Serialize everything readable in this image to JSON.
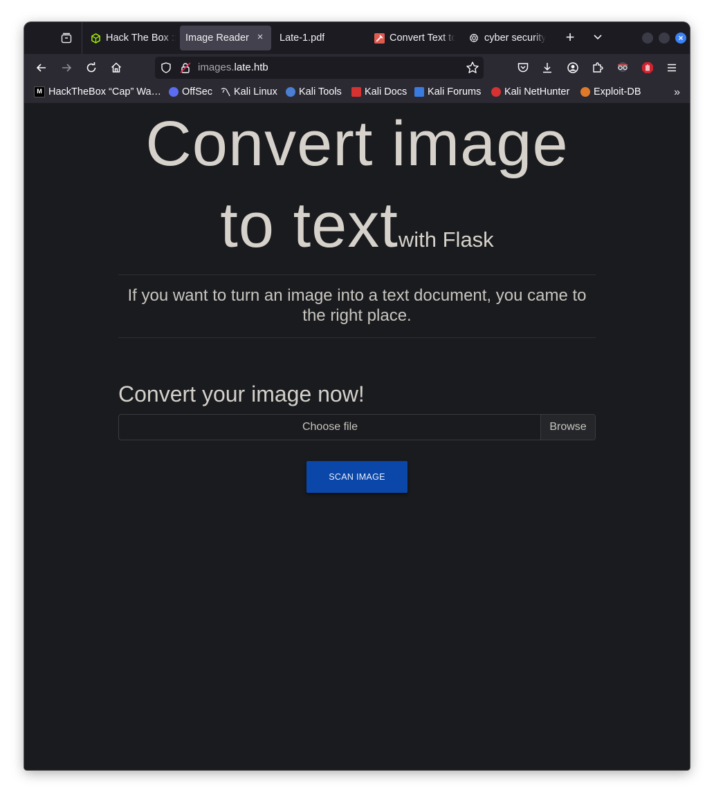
{
  "browser": {
    "tabs": [
      {
        "title": "Hack The Box ::",
        "icon": "htb-cube-icon",
        "active": false
      },
      {
        "title": "Image Reader",
        "icon": "",
        "active": true
      },
      {
        "title": "Late-1.pdf",
        "icon": "pdf-icon",
        "active": false
      },
      {
        "title": "Convert Text to",
        "icon": "tool-icon",
        "active": false
      },
      {
        "title": "cyber security",
        "icon": "chatgpt-icon",
        "active": false
      }
    ],
    "new_tab_label": "+",
    "close_tab_label": "×",
    "url": {
      "subdomain": "images.",
      "domain": "late.htb"
    },
    "bookmarks": [
      {
        "label": "HackTheBox “Cap” Wa…",
        "color": "#000000"
      },
      {
        "label": "OffSec",
        "color": "#5b6cf0"
      },
      {
        "label": "Kali Linux",
        "color": "#2b2a33"
      },
      {
        "label": "Kali Tools",
        "color": "#4a7fd4"
      },
      {
        "label": "Kali Docs",
        "color": "#d63232"
      },
      {
        "label": "Kali Forums",
        "color": "#3a7be0"
      },
      {
        "label": "Kali NetHunter",
        "color": "#d63232"
      },
      {
        "label": "Exploit-DB",
        "color": "#e07a2a"
      }
    ],
    "bookmarks_more": "»"
  },
  "page": {
    "title_line1": "Convert image",
    "title_line2": "to text",
    "title_small": "with Flask",
    "lead": "If you want to turn an image into a text document, you came to the right place.",
    "subhead": "Convert your image now!",
    "file_placeholder": "Choose file",
    "browse_label": "Browse",
    "scan_button": "SCAN IMAGE"
  }
}
